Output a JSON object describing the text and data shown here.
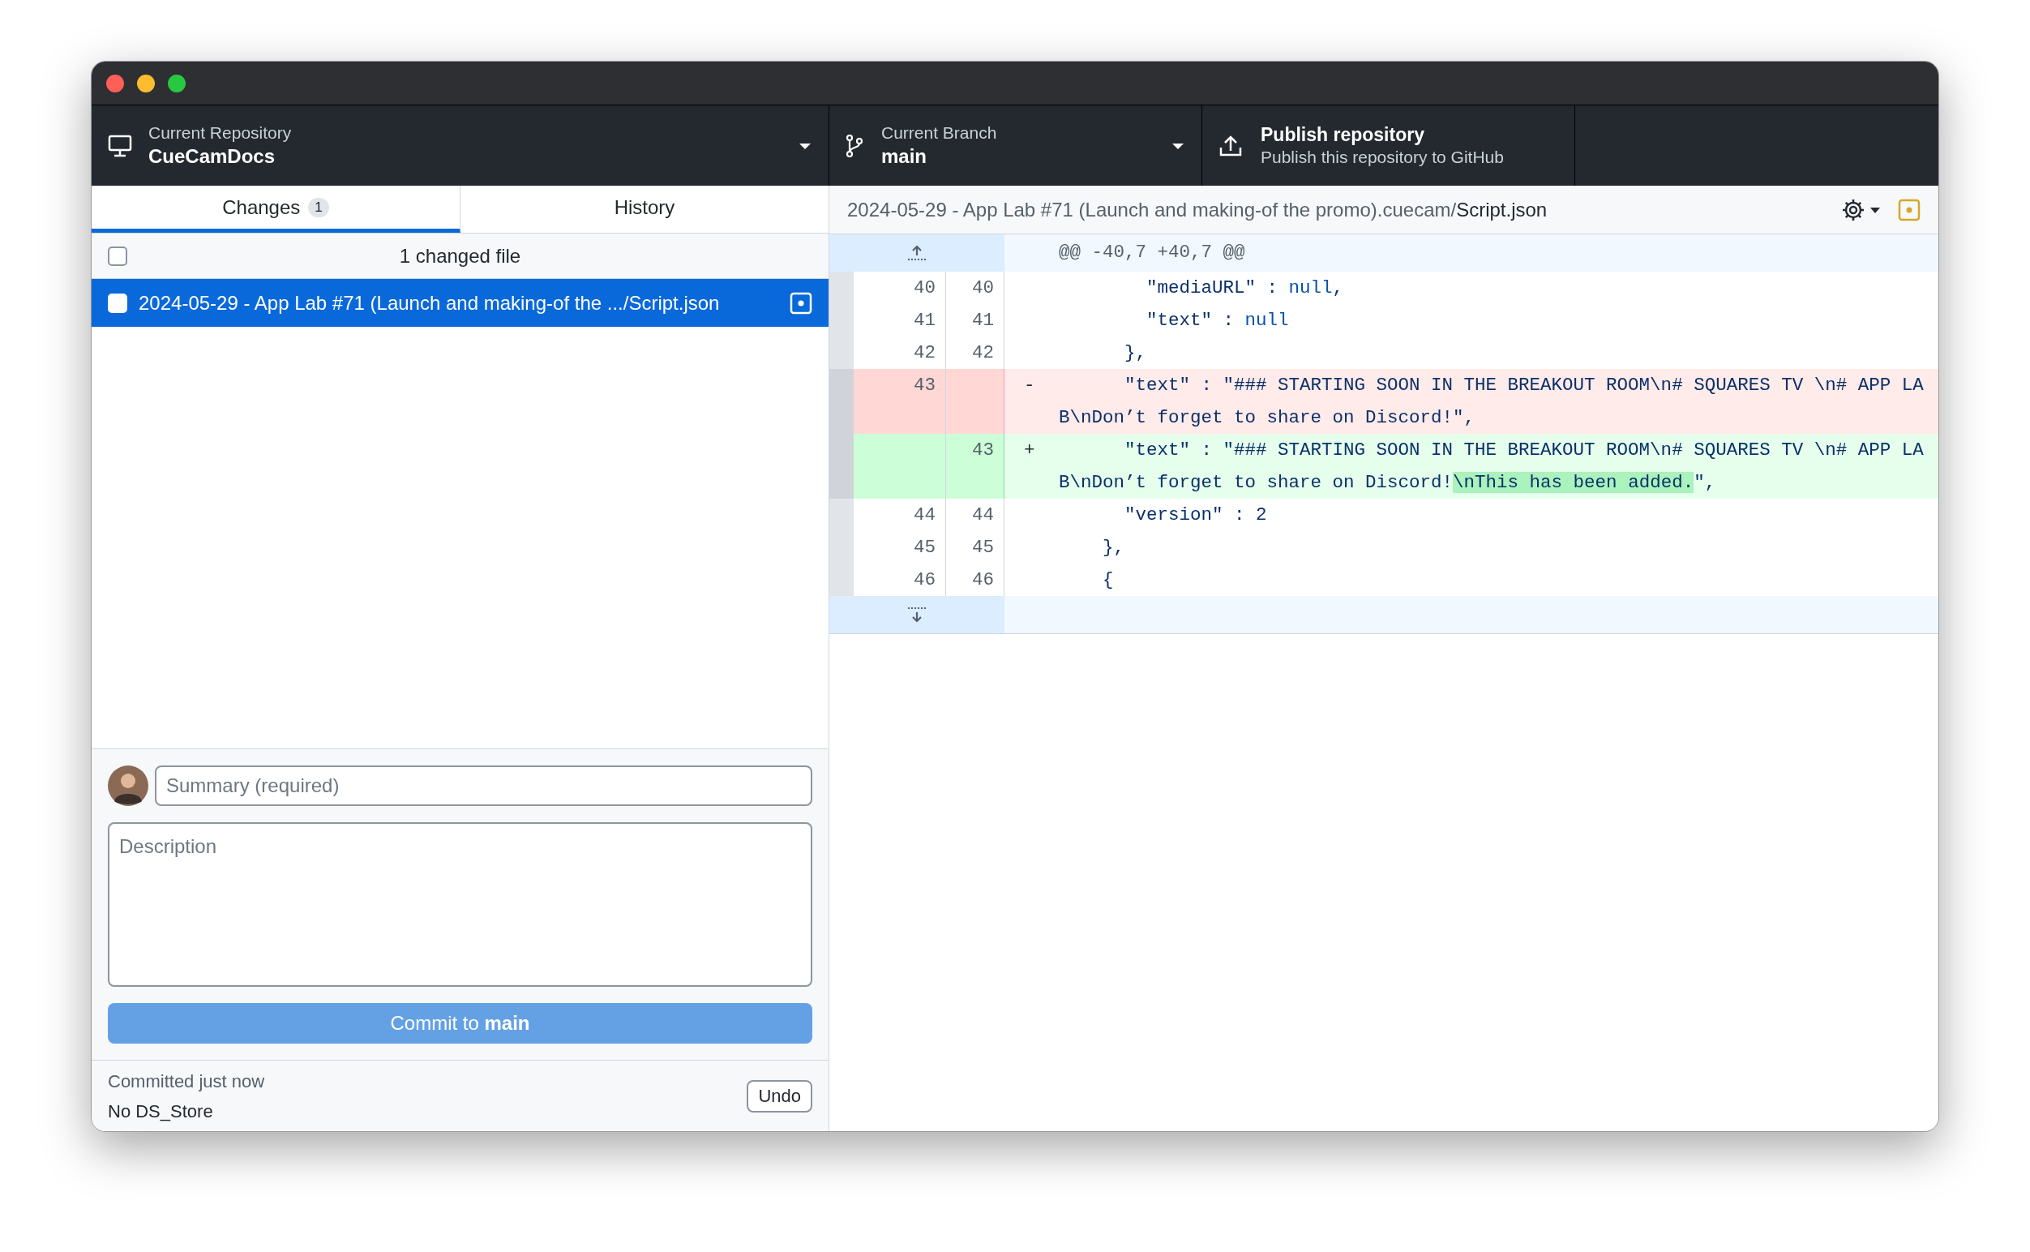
{
  "toolbar": {
    "repository": {
      "label": "Current Repository",
      "value": "CueCamDocs"
    },
    "branch": {
      "label": "Current Branch",
      "value": "main"
    },
    "publish": {
      "label": "Publish repository",
      "description": "Publish this repository to GitHub"
    }
  },
  "tabs": [
    {
      "label": "Changes",
      "count": "1",
      "selected": true
    },
    {
      "label": "History",
      "selected": false
    }
  ],
  "changes": {
    "summary": "1 changed file",
    "all_checked": false,
    "files": [
      {
        "path": "2024-05-29 - App Lab #71 (Launch and making-of the .../Script.json",
        "checked": false,
        "selected": true
      }
    ]
  },
  "commit": {
    "summary_field": {
      "placeholder": "Summary (required)"
    },
    "description_field": {
      "placeholder": "Description"
    },
    "button": "Commit to **main**"
  },
  "last_commit": {
    "status": "Committed just now",
    "message": "No DS_Store",
    "undo": "Undo"
  },
  "diff": {
    "directory": "2024-05-29 - App Lab #71 (Launch and making-of the promo).cuecam/",
    "file_name": "Script.json",
    "hunk": "@@ -40,7 +40,7 @@",
    "lines": [
      {
        "kind": "context",
        "old": "40",
        "new": "40",
        "code": [
          {
            "kind": "plain",
            "text": "        \"mediaURL\" : "
          },
          {
            "kind": "keyword",
            "text": "null"
          },
          {
            "kind": "plain",
            "text": ","
          }
        ]
      },
      {
        "kind": "context",
        "old": "41",
        "new": "41",
        "code": [
          {
            "kind": "plain",
            "text": "        \"text\" : "
          },
          {
            "kind": "keyword",
            "text": "null"
          }
        ]
      },
      {
        "kind": "context",
        "old": "42",
        "new": "42",
        "code": [
          {
            "kind": "plain",
            "text": "      },"
          }
        ]
      },
      {
        "kind": "deleted",
        "old": "43",
        "marker": "-",
        "code": [
          {
            "kind": "plain",
            "text": "      \"text\" : \"### STARTING SOON IN THE BREAKOUT ROOM\\n# SQUARES TV \\n# APP LAB\\nDon’t forget to share on Discord!\","
          }
        ]
      },
      {
        "kind": "added",
        "new": "43",
        "marker": "+",
        "code": [
          {
            "kind": "plain",
            "text": "      \"text\" : \"### STARTING SOON IN THE BREAKOUT ROOM\\n# SQUARES TV \\n# APP LAB\\nDon’t forget to share on Discord!"
          },
          {
            "kind": "highlight",
            "text": "\\nThis has been added."
          },
          {
            "kind": "plain",
            "text": "\","
          }
        ]
      },
      {
        "kind": "context",
        "old": "44",
        "new": "44",
        "code": [
          {
            "kind": "plain",
            "text": "      \"version\" : 2"
          }
        ]
      },
      {
        "kind": "context",
        "old": "45",
        "new": "45",
        "code": [
          {
            "kind": "plain",
            "text": "    },"
          }
        ]
      },
      {
        "kind": "context",
        "old": "46",
        "new": "46",
        "code": [
          {
            "kind": "plain",
            "text": "    {"
          }
        ]
      }
    ]
  }
}
